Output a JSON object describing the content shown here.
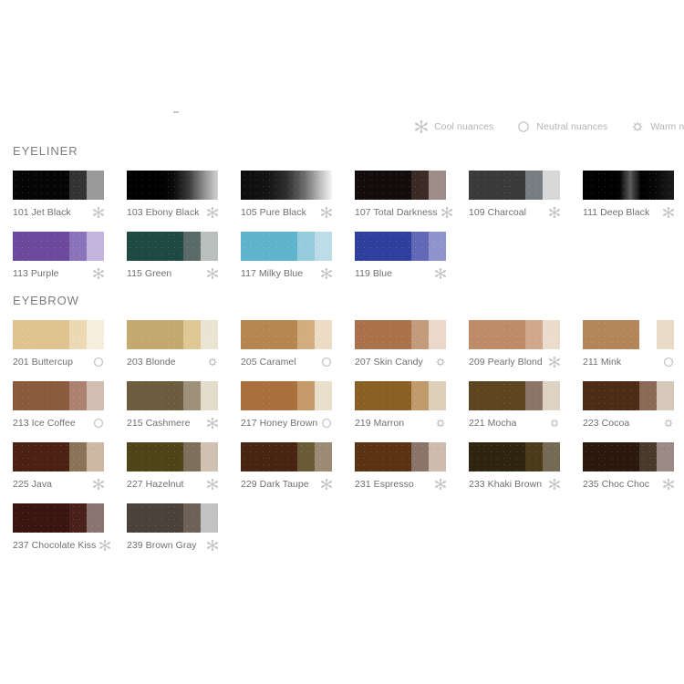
{
  "legend": {
    "items": [
      {
        "icon": "snowflake-icon",
        "label": "Cool nuances",
        "key": "cool"
      },
      {
        "icon": "circle-icon",
        "label": "Neutral nuances",
        "key": "neutral"
      },
      {
        "icon": "sun-icon",
        "label": "Warm nuances",
        "key": "warm"
      }
    ]
  },
  "colors": {
    "text": "#6f6f6f",
    "legend_text": "#b3b3b3",
    "section_title": "#7d7d7d",
    "icon": "#c2c2c2",
    "background": "#ffffff"
  },
  "sections": [
    {
      "id": "eyeliner",
      "title": "EYELINER",
      "swatches": [
        {
          "name": "101 Jet Black",
          "nuance": "cool",
          "bands": [
            "#050505",
            "#333333",
            "#9a9a9a"
          ],
          "style": "bands"
        },
        {
          "name": "103 Ebony Black",
          "nuance": "cool",
          "bands": [
            "#000000",
            "#151515",
            "#c9c9c9"
          ],
          "style": "gradient",
          "gradient": "linear-gradient(90deg,#000000 0%,#000000 38%,#0d0d0d 52%,#3a3a3a 68%,#8d8d8d 84%,#d2d2d2 100%)"
        },
        {
          "name": "105 Pure Black",
          "nuance": "cool",
          "bands": [
            "#0a0a0a",
            "#565656",
            "#f2f2f2"
          ],
          "style": "gradient",
          "gradient": "linear-gradient(90deg,#0c0c0c 0%,#141414 30%,#2e2e2e 50%,#6e6e6e 70%,#b8b8b8 86%,#f6f6f6 100%)"
        },
        {
          "name": "107 Total Darkness",
          "nuance": "cool",
          "bands": [
            "#120d0c",
            "#3b2b24",
            "#9c8d88"
          ],
          "style": "bands"
        },
        {
          "name": "109 Charcoal",
          "nuance": "cool",
          "bands": [
            "#3a3a3a",
            "#787d82",
            "#d8d8d8"
          ],
          "style": "bands"
        },
        {
          "name": "111 Deep Black",
          "nuance": "cool",
          "bands": [
            "#000000",
            "#0a0a0a",
            "#101010"
          ],
          "style": "gradient",
          "gradient": "linear-gradient(90deg,#000000 0%,#000000 40%,#5c5c5c 52%,#000000 64%,#0a0a0a 82%,#1c1c1c 100%)"
        },
        {
          "name": "113 Purple",
          "nuance": "cool",
          "bands": [
            "#6b4a9e",
            "#8a73b8",
            "#c3b5de"
          ],
          "style": "bands"
        },
        {
          "name": "115 Green",
          "nuance": "cool",
          "bands": [
            "#1f4a43",
            "#5a6a66",
            "#b8bfbd"
          ],
          "style": "bands"
        },
        {
          "name": "117 Milky Blue",
          "nuance": "cool",
          "bands": [
            "#5fb3cd",
            "#96cbdc",
            "#bcdde7"
          ],
          "style": "bands"
        },
        {
          "name": "119 Blue",
          "nuance": "cool",
          "bands": [
            "#2f3f9e",
            "#6168b5",
            "#9094cc"
          ],
          "style": "bands"
        }
      ]
    },
    {
      "id": "eyebrow",
      "title": "EYEBROW",
      "swatches": [
        {
          "name": "201 Buttercup",
          "nuance": "neutral",
          "bands": [
            "#e0c48f",
            "#ecd9b4",
            "#f6eedd"
          ],
          "style": "bands"
        },
        {
          "name": "203 Blonde",
          "nuance": "warm",
          "bands": [
            "#c4a96e",
            "#dfc894",
            "#ece4d2"
          ],
          "style": "bands"
        },
        {
          "name": "205 Caramel",
          "nuance": "neutral",
          "bands": [
            "#b5864f",
            "#d2ad80",
            "#ecdcc6"
          ],
          "style": "bands"
        },
        {
          "name": "207 Skin Candy",
          "nuance": "warm",
          "bands": [
            "#a9724a",
            "#c39b7c",
            "#ead9c9"
          ],
          "style": "bands"
        },
        {
          "name": "209 Pearly Blond",
          "nuance": "cool",
          "bands": [
            "#bd8b68",
            "#cfa88c",
            "#ecdccb"
          ],
          "style": "bands"
        },
        {
          "name": "211 Mink",
          "nuance": "neutral",
          "bands": [
            "#b5855a",
            "#d9b display",
            "#eadbc6"
          ],
          "style": "bands"
        },
        {
          "name": "213 Ice Coffee",
          "nuance": "neutral",
          "bands": [
            "#8a5a3c",
            "#ab8270",
            "#d2bdb3"
          ],
          "style": "bands"
        },
        {
          "name": "215 Cashmere",
          "nuance": "cool",
          "bands": [
            "#6b5c3e",
            "#9c9079",
            "#e3dcca"
          ],
          "style": "bands"
        },
        {
          "name": "217 Honey Brown",
          "nuance": "neutral",
          "bands": [
            "#a96f3c",
            "#c79a6a",
            "#eadfcb"
          ],
          "style": "bands"
        },
        {
          "name": "219 Marron",
          "nuance": "warm",
          "bands": [
            "#8a5f24",
            "#c09a6a",
            "#ded0b8"
          ],
          "style": "bands"
        },
        {
          "name": "221 Mocha",
          "nuance": "warm",
          "bands": [
            "#5c4520",
            "#8c7567",
            "#ded2c2"
          ],
          "style": "bands"
        },
        {
          "name": "223 Cocoa",
          "nuance": "warm",
          "bands": [
            "#4d2c16",
            "#8a6a56",
            "#d6c8ba"
          ],
          "style": "bands"
        },
        {
          "name": "225 Java",
          "nuance": "cool",
          "bands": [
            "#4a2112",
            "#8a7357",
            "#cdb9a3"
          ],
          "style": "bands"
        },
        {
          "name": "227 Hazelnut",
          "nuance": "cool",
          "bands": [
            "#4f4417",
            "#7d6f5c",
            "#cfc2b0"
          ],
          "style": "bands"
        },
        {
          "name": "229 Dark Taupe",
          "nuance": "cool",
          "bands": [
            "#4a2412",
            "#6b5a36",
            "#9c8a74"
          ],
          "style": "bands"
        },
        {
          "name": "231 Espresso",
          "nuance": "cool",
          "bands": [
            "#5a3315",
            "#8a7468",
            "#cdbcab"
          ],
          "style": "bands"
        },
        {
          "name": "233 Khaki Brown",
          "nuance": "cool",
          "bands": [
            "#2e2410",
            "#4a3c18",
            "#756a54"
          ],
          "style": "bands"
        },
        {
          "name": "235 Choc Choc",
          "nuance": "cool",
          "bands": [
            "#2b180e",
            "#4a3a2c",
            "#9a8a84"
          ],
          "style": "bands"
        },
        {
          "name": "237 Chocolate Kiss",
          "nuance": "cool",
          "bands": [
            "#3a1410",
            "#4a201a",
            "#8a7470"
          ],
          "style": "bands"
        },
        {
          "name": "239 Brown Gray",
          "nuance": "cool",
          "bands": [
            "#4a4238",
            "#6e6258",
            "#c2c2c2"
          ],
          "style": "bands"
        }
      ]
    }
  ]
}
